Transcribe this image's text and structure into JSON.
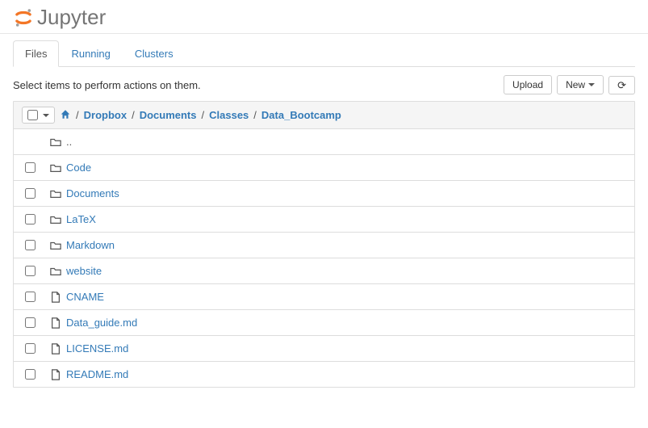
{
  "brand": "Jupyter",
  "tabs": [
    {
      "label": "Files",
      "active": true
    },
    {
      "label": "Running",
      "active": false
    },
    {
      "label": "Clusters",
      "active": false
    }
  ],
  "hint": "Select items to perform actions on them.",
  "actions": {
    "upload": "Upload",
    "new": "New"
  },
  "breadcrumb": [
    "Dropbox",
    "Documents",
    "Classes",
    "Data_Bootcamp"
  ],
  "items": [
    {
      "type": "parent",
      "name": ".."
    },
    {
      "type": "folder",
      "name": "Code"
    },
    {
      "type": "folder",
      "name": "Documents"
    },
    {
      "type": "folder",
      "name": "LaTeX"
    },
    {
      "type": "folder",
      "name": "Markdown"
    },
    {
      "type": "folder",
      "name": "website"
    },
    {
      "type": "file",
      "name": "CNAME"
    },
    {
      "type": "file",
      "name": "Data_guide.md"
    },
    {
      "type": "file",
      "name": "LICENSE.md"
    },
    {
      "type": "file",
      "name": "README.md"
    }
  ]
}
